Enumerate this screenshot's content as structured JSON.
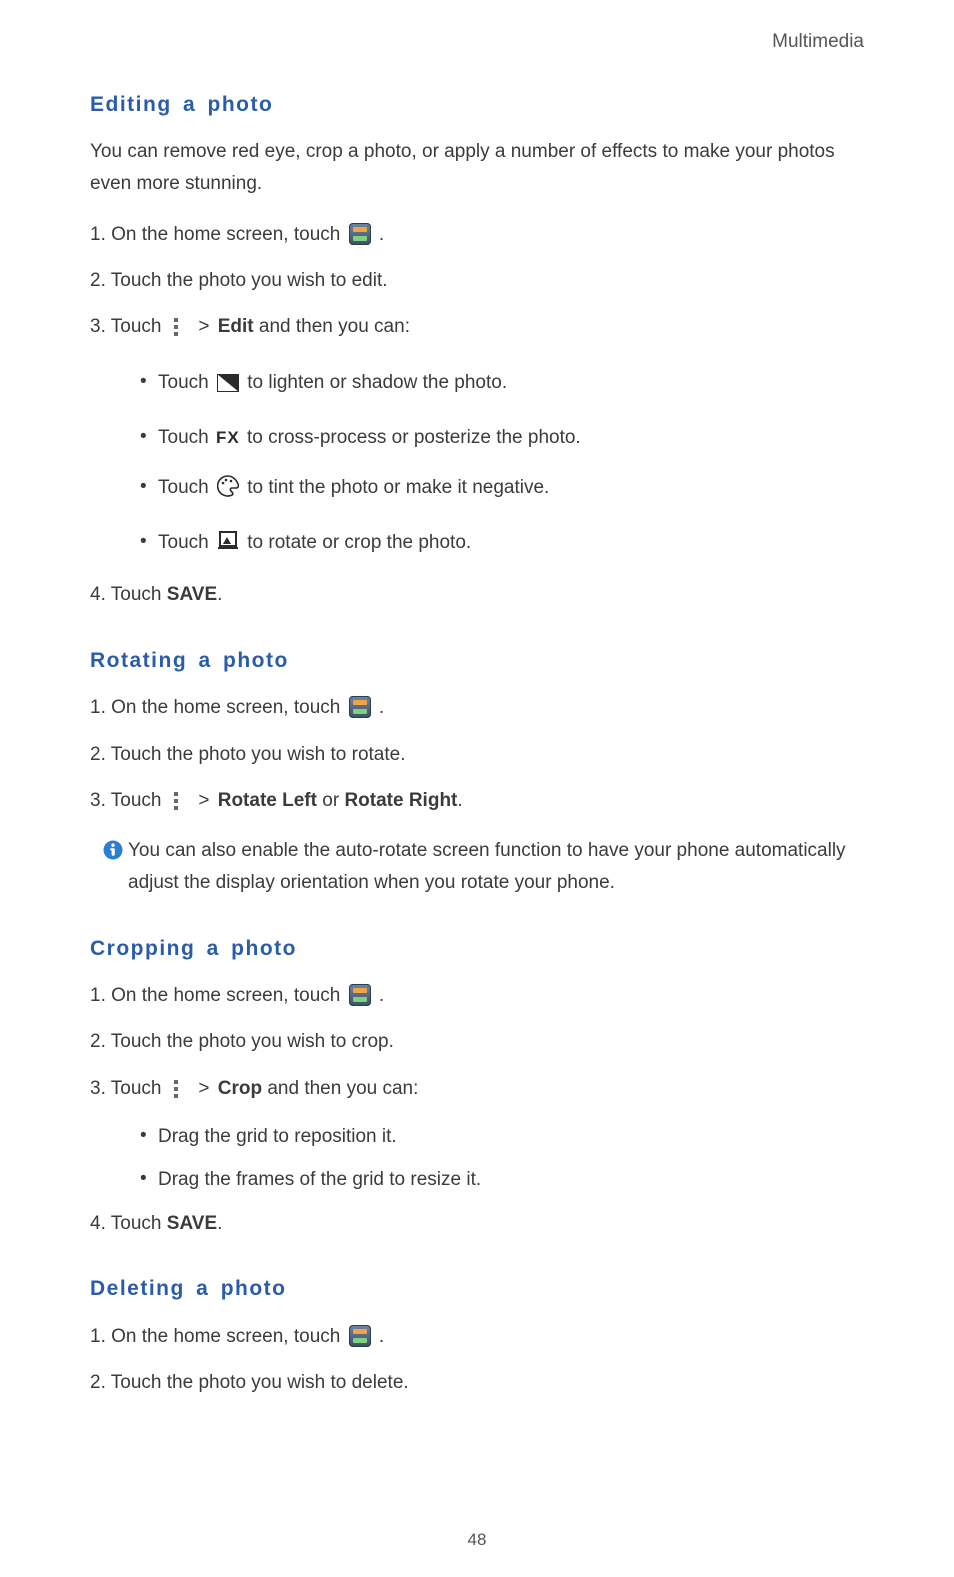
{
  "chapter": "Multimedia",
  "pageNumber": "48",
  "sections": {
    "editing": {
      "title": "Editing a photo",
      "intro": "You can remove red eye, crop a photo, or apply a number of effects to make your photos even more stunning.",
      "step1_a": "On the home screen, touch ",
      "step1_b": " .",
      "step2": "Touch the photo you wish to edit.",
      "step3_a": "Touch ",
      "step3_gt": ">",
      "step3_bold": "Edit",
      "step3_b": " and then you can:",
      "sub1_a": "Touch ",
      "sub1_b": " to lighten or shadow the photo.",
      "sub2_a": "Touch ",
      "sub2_fx": "FX",
      "sub2_b": " to cross-process or posterize the photo.",
      "sub3_a": "Touch ",
      "sub3_b": " to tint the photo or make it negative.",
      "sub4_a": "Touch ",
      "sub4_b": " to rotate or crop the photo.",
      "step4_a": "Touch ",
      "step4_bold": "SAVE",
      "step4_b": "."
    },
    "rotating": {
      "title": "Rotating a photo",
      "step1_a": "On the home screen, touch ",
      "step1_b": " .",
      "step2": "Touch the photo you wish to rotate.",
      "step3_a": "Touch ",
      "step3_gt": ">",
      "step3_b": " ",
      "step3_bold1": "Rotate Left",
      "step3_or": " or ",
      "step3_bold2": "Rotate Right",
      "step3_c": ".",
      "info": "You can also enable the auto-rotate screen function to have your phone automatically adjust the display orientation when you rotate your phone."
    },
    "cropping": {
      "title": "Cropping a photo",
      "step1_a": "On the home screen, touch ",
      "step1_b": " .",
      "step2": "Touch the photo you wish to crop.",
      "step3_a": "Touch ",
      "step3_gt": ">",
      "step3_bold": "Crop",
      "step3_b": " and then you can:",
      "sub1": "Drag the grid to reposition it.",
      "sub2": "Drag the frames of the grid to resize it.",
      "step4_a": "Touch ",
      "step4_bold": "SAVE",
      "step4_b": "."
    },
    "deleting": {
      "title": "Deleting a photo",
      "step1_a": "On the home screen, touch ",
      "step1_b": " .",
      "step2": "Touch the photo you wish to delete."
    }
  },
  "labels": {
    "n1": "1.",
    "n2": "2.",
    "n3": "3.",
    "n4": "4."
  }
}
